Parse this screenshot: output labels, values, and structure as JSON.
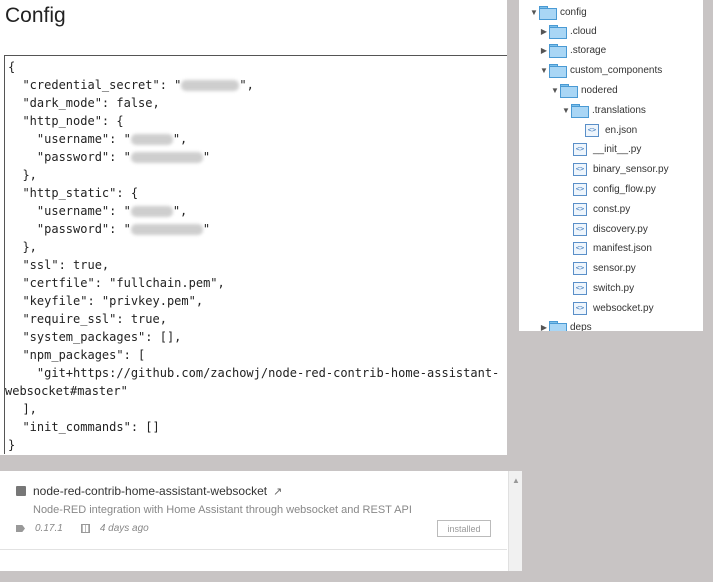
{
  "config": {
    "title": "Config",
    "code_lines": [
      "{",
      "  \"credential_secret\": \"",
      "  \"dark_mode\": false,",
      "  \"http_node\": {",
      "    \"username\": \"",
      "    \"password\": \"",
      "  },",
      "  \"http_static\": {",
      "    \"username\": \"",
      "    \"password\": \"",
      "  },",
      "  \"ssl\": true,",
      "  \"certfile\": \"fullchain.pem\",",
      "  \"keyfile\": \"privkey.pem\",",
      "  \"require_ssl\": true,",
      "  \"system_packages\": [],",
      "  \"npm_packages\": [",
      "    \"git+https://github.com/zachowj/node-red-contrib-home-assistant-",
      "websocket#master\"",
      "  ],",
      "  \"init_commands\": []",
      "}"
    ],
    "redacted_suffix": "\","
  },
  "file_tree": {
    "items": [
      {
        "label": "config",
        "type": "folder",
        "expanded": true
      },
      {
        "label": ".cloud",
        "type": "folder",
        "expanded": false
      },
      {
        "label": ".storage",
        "type": "folder",
        "expanded": false
      },
      {
        "label": "custom_components",
        "type": "folder",
        "expanded": true
      },
      {
        "label": "nodered",
        "type": "folder",
        "expanded": true
      },
      {
        "label": ".translations",
        "type": "folder",
        "expanded": true
      },
      {
        "label": "en.json",
        "type": "file"
      },
      {
        "label": "__init__.py",
        "type": "file"
      },
      {
        "label": "binary_sensor.py",
        "type": "file"
      },
      {
        "label": "config_flow.py",
        "type": "file"
      },
      {
        "label": "const.py",
        "type": "file"
      },
      {
        "label": "discovery.py",
        "type": "file"
      },
      {
        "label": "manifest.json",
        "type": "file"
      },
      {
        "label": "sensor.py",
        "type": "file"
      },
      {
        "label": "switch.py",
        "type": "file"
      },
      {
        "label": "websocket.py",
        "type": "file"
      },
      {
        "label": "deps",
        "type": "folder",
        "expanded": false
      }
    ]
  },
  "addon": {
    "name": "node-red-contrib-home-assistant-websocket",
    "description": "Node-RED integration with Home Assistant through websocket and REST API",
    "version": "0.17.1",
    "updated": "4 days ago",
    "status": "installed",
    "icons": {
      "package": "package-icon",
      "external": "external-link-icon",
      "tag": "tag-icon",
      "calendar": "calendar-icon"
    }
  }
}
